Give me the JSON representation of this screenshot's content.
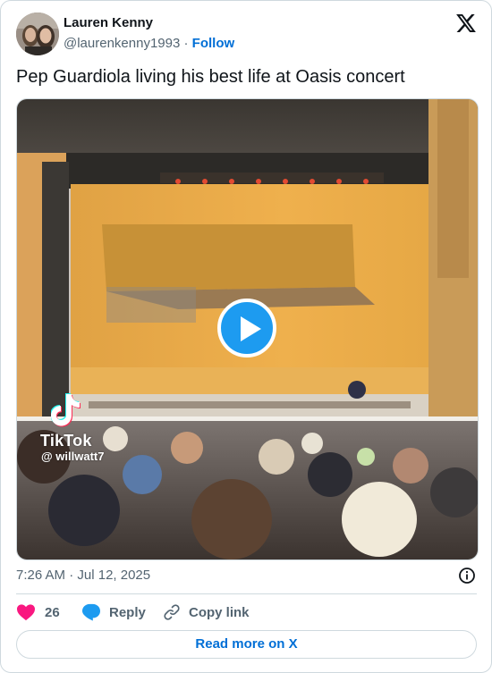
{
  "author": {
    "name": "Lauren Kenny",
    "handle": "@laurenkenny1993",
    "separator": "·",
    "follow_label": "Follow"
  },
  "tweet": {
    "text": "Pep Guardiola living his best life at Oasis concert",
    "time": "7:26 AM",
    "date": "Jul 12, 2025",
    "date_separator": "·"
  },
  "media": {
    "type": "video",
    "watermark_brand": "TikTok",
    "watermark_user": "@ willwatt7",
    "play_icon": "play-icon"
  },
  "actions": {
    "likes_count": "26",
    "reply_label": "Reply",
    "copy_link_label": "Copy link"
  },
  "footer": {
    "read_more_label": "Read more on X"
  },
  "colors": {
    "accent": "#1d9bf0",
    "link": "#006fd6",
    "like": "#f91880",
    "muted": "#536471",
    "border": "#cfd9de"
  }
}
